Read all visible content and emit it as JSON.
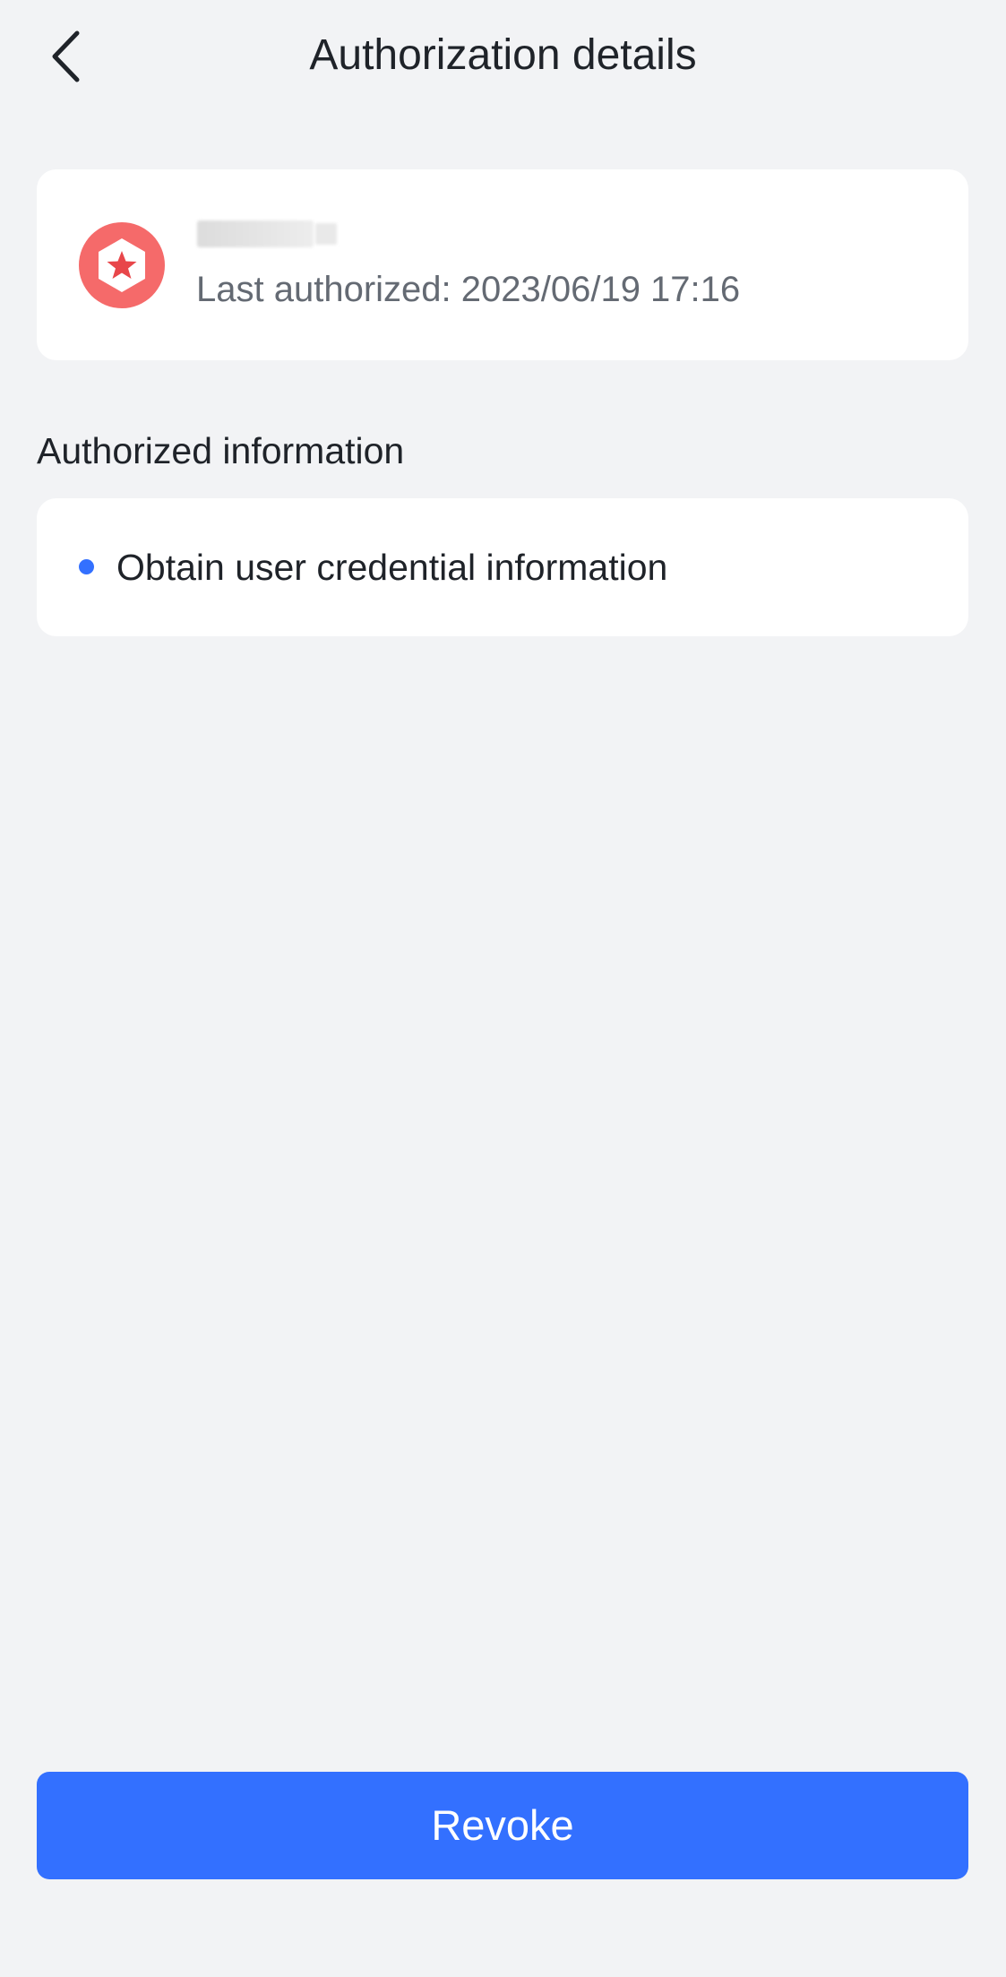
{
  "header": {
    "title": "Authorization details",
    "back_icon": "chevron-left-icon"
  },
  "app_card": {
    "icon": "hexagon-star-icon",
    "icon_color": "#f56a6a",
    "name": "",
    "last_authorized": "Last authorized: 2023/06/19 17:16"
  },
  "authorized_info": {
    "label": "Authorized information",
    "items": [
      {
        "text": "Obtain user credential information"
      }
    ]
  },
  "actions": {
    "revoke_label": "Revoke"
  },
  "colors": {
    "accent": "#3370ff",
    "background": "#f2f3f5",
    "card": "#ffffff"
  }
}
